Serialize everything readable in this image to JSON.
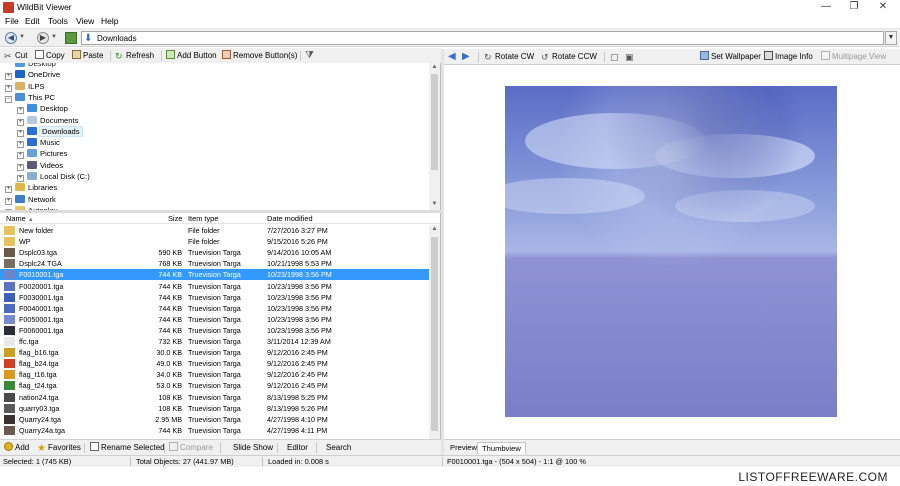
{
  "window": {
    "title": "WildBit Viewer",
    "minimize": "—",
    "maximize": "❐",
    "close": "✕"
  },
  "menu": [
    "File",
    "Edit",
    "Tools",
    "View",
    "Help"
  ],
  "address": {
    "path": "Downloads"
  },
  "left_toolbar": {
    "cut": "Cut",
    "copy": "Copy",
    "paste": "Paste",
    "refresh": "Refresh",
    "add_button": "Add Button",
    "remove_buttons": "Remove Button(s)"
  },
  "right_toolbar": {
    "rotate_cw": "Rotate CW",
    "rotate_ccw": "Rotate CCW",
    "set_wallpaper": "Set Wallpaper",
    "image_info": "Image Info",
    "multipage_view": "Multipage View"
  },
  "tree": [
    {
      "label": "Desktop",
      "indent": 0,
      "expander": "",
      "icon": "desktop-icon",
      "color": "#3b8fe0",
      "partial": true
    },
    {
      "label": "OneDrive",
      "indent": 0,
      "expander": "+",
      "icon": "cloud-icon",
      "color": "#1d64c9"
    },
    {
      "label": "ILPS",
      "indent": 0,
      "expander": "+",
      "icon": "user-icon",
      "color": "#d8b06a"
    },
    {
      "label": "This PC",
      "indent": 0,
      "expander": "−",
      "icon": "computer-icon",
      "color": "#4b8fd8"
    },
    {
      "label": "Desktop",
      "indent": 1,
      "expander": "+",
      "icon": "desktop-icon",
      "color": "#3b8fe0"
    },
    {
      "label": "Documents",
      "indent": 1,
      "expander": "+",
      "icon": "documents-icon",
      "color": "#b9c9df"
    },
    {
      "label": "Downloads",
      "indent": 1,
      "expander": "+",
      "icon": "download-icon",
      "color": "#2a6fd6",
      "selected": true
    },
    {
      "label": "Music",
      "indent": 1,
      "expander": "+",
      "icon": "music-icon",
      "color": "#2a6fd6"
    },
    {
      "label": "Pictures",
      "indent": 1,
      "expander": "+",
      "icon": "pictures-icon",
      "color": "#6aa0d8"
    },
    {
      "label": "Videos",
      "indent": 1,
      "expander": "+",
      "icon": "videos-icon",
      "color": "#5a5a7a"
    },
    {
      "label": "Local Disk (C:)",
      "indent": 1,
      "expander": "+",
      "icon": "drive-icon",
      "color": "#8ab0d0"
    },
    {
      "label": "Libraries",
      "indent": 0,
      "expander": "+",
      "icon": "libraries-icon",
      "color": "#e0b84a"
    },
    {
      "label": "Network",
      "indent": 0,
      "expander": "+",
      "icon": "network-icon",
      "color": "#3f7fc8"
    },
    {
      "label": "Autoplay",
      "indent": 0,
      "expander": "+",
      "icon": "folder-icon",
      "color": "#e6c35c",
      "partial": true
    }
  ],
  "columns": {
    "name": "Name",
    "size": "Size",
    "type": "Item type",
    "date": "Date modified"
  },
  "files": [
    {
      "name": "New folder",
      "size": "",
      "type": "File folder",
      "date": "7/27/2016 3:27 PM",
      "thumb": "#e6c35c"
    },
    {
      "name": "WP",
      "size": "",
      "type": "File folder",
      "date": "9/15/2016 5:26 PM",
      "thumb": "#e6c35c"
    },
    {
      "name": "Dsplc03.tga",
      "size": "590 KB",
      "type": "Truevision Targa",
      "date": "9/14/2016 10:05 AM",
      "thumb": "#6a5a4a"
    },
    {
      "name": "Dsplc24.TGA",
      "size": "768 KB",
      "type": "Truevision Targa",
      "date": "10/21/1998 5:53 PM",
      "thumb": "#7a6d62"
    },
    {
      "name": "F0010001.tga",
      "size": "744 KB",
      "type": "Truevision Targa",
      "date": "10/23/1998 3:56 PM",
      "thumb": "#6d84c9",
      "selected": true
    },
    {
      "name": "F0020001.tga",
      "size": "744 KB",
      "type": "Truevision Targa",
      "date": "10/23/1998 3:56 PM",
      "thumb": "#5a74c2"
    },
    {
      "name": "F0030001.tga",
      "size": "744 KB",
      "type": "Truevision Targa",
      "date": "10/23/1998 3:56 PM",
      "thumb": "#3d5fb8"
    },
    {
      "name": "F0040001.tga",
      "size": "744 KB",
      "type": "Truevision Targa",
      "date": "10/23/1998 3:56 PM",
      "thumb": "#4b6ac0"
    },
    {
      "name": "F0050001.tga",
      "size": "744 KB",
      "type": "Truevision Targa",
      "date": "10/23/1998 3:56 PM",
      "thumb": "#7a8ad0"
    },
    {
      "name": "F0060001.tga",
      "size": "744 KB",
      "type": "Truevision Targa",
      "date": "10/23/1998 3:56 PM",
      "thumb": "#2d2d3a"
    },
    {
      "name": "ffc.tga",
      "size": "732 KB",
      "type": "Truevision Targa",
      "date": "3/11/2014 12:39 AM",
      "thumb": "#e8e8e8"
    },
    {
      "name": "flag_b16.tga",
      "size": "30.0 KB",
      "type": "Truevision Targa",
      "date": "9/12/2016 2:45 PM",
      "thumb": "#c9a020"
    },
    {
      "name": "flag_b24.tga",
      "size": "49.0 KB",
      "type": "Truevision Targa",
      "date": "9/12/2016 2:45 PM",
      "thumb": "#d04020"
    },
    {
      "name": "flag_t16.tga",
      "size": "34.0 KB",
      "type": "Truevision Targa",
      "date": "9/12/2016 2:45 PM",
      "thumb": "#d89a20"
    },
    {
      "name": "flag_t24.tga",
      "size": "53.0 KB",
      "type": "Truevision Targa",
      "date": "9/12/2016 2:45 PM",
      "thumb": "#3a8a3a"
    },
    {
      "name": "nation24.tga",
      "size": "108 KB",
      "type": "Truevision Targa",
      "date": "8/13/1998 5:25 PM",
      "thumb": "#4a4a4a"
    },
    {
      "name": "quarry03.tga",
      "size": "108 KB",
      "type": "Truevision Targa",
      "date": "8/13/1998 5:26 PM",
      "thumb": "#5a5a5a"
    },
    {
      "name": "Quarry24.tga",
      "size": "2.95 MB",
      "type": "Truevision Targa",
      "date": "4/27/1998 4:10 PM",
      "thumb": "#3a3230"
    },
    {
      "name": "Quarry24a.tga",
      "size": "744 KB",
      "type": "Truevision Targa",
      "date": "4/27/1998 4:11 PM",
      "thumb": "#6a5a50"
    }
  ],
  "bottom_toolbar": {
    "add": "Add",
    "favorites": "Favorites",
    "rename_selected": "Rename Selected",
    "compare": "Compare",
    "slide_show": "Slide Show",
    "editor": "Editor",
    "search": "Search"
  },
  "tabs": {
    "preview": "Preview",
    "thumbview": "Thumbview"
  },
  "status": {
    "selected": "Selected: 1 (745 KB)",
    "total": "Total Objects: 27 (441.97 MB)",
    "loaded": "Loaded in: 0.008 s",
    "image": "F0010001.tga - (504 x 504) - 1:1 @ 100 %"
  },
  "watermark": "LISTOFFREEWARE.COM",
  "colors": {
    "selection": "#3399ff",
    "accent_blue": "#2a6fd6"
  }
}
